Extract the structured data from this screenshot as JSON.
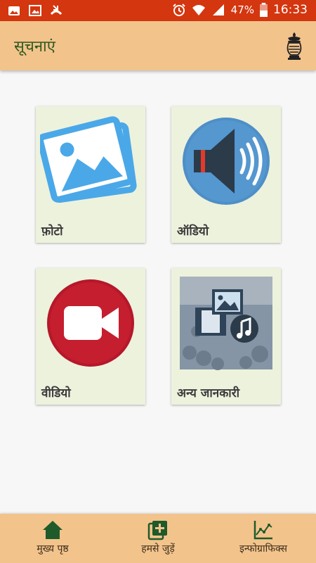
{
  "status_bar": {
    "battery": "47%",
    "time": "16:33",
    "icons": [
      "gallery-icon",
      "image-icon",
      "missed-call-icon",
      "alarm-icon",
      "wifi-icon",
      "signal-icon",
      "battery-icon"
    ]
  },
  "app_bar": {
    "title": "सूचनाएं",
    "emblem_icon": "kalash-emblem-icon"
  },
  "tiles": [
    {
      "label": "फ़ोटो",
      "icon": "photos-icon"
    },
    {
      "label": "ऑडियो",
      "icon": "speaker-icon"
    },
    {
      "label": "वीडियो",
      "icon": "video-camera-icon"
    },
    {
      "label": "अन्य जानकारी",
      "icon": "media-icon"
    }
  ],
  "bottom_nav": [
    {
      "label": "मुख्य पृष्ठ",
      "icon": "home-icon"
    },
    {
      "label": "हमसे जुड़ें",
      "icon": "add-box-icon"
    },
    {
      "label": "इन्फोग्राफिक्स",
      "icon": "chart-icon"
    }
  ],
  "colors": {
    "status_bar": "#d4360f",
    "app_bar": "#f3c38c",
    "title_green": "#2d5a1e",
    "tile_bg": "#edf2dd",
    "nav_icon_green": "#1f5a2a"
  }
}
